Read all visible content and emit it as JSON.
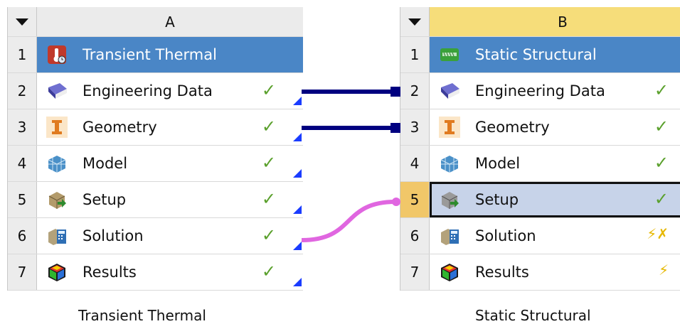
{
  "systems": [
    {
      "column_letter": "A",
      "caption": "Transient Thermal",
      "rows": [
        {
          "num": "1",
          "label": "Transient Thermal",
          "icon": "thermal-system-icon"
        },
        {
          "num": "2",
          "label": "Engineering Data",
          "icon": "engineering-data-icon",
          "status": "✓"
        },
        {
          "num": "3",
          "label": "Geometry",
          "icon": "geometry-icon",
          "status": "✓"
        },
        {
          "num": "4",
          "label": "Model",
          "icon": "model-icon",
          "status": "✓"
        },
        {
          "num": "5",
          "label": "Setup",
          "icon": "setup-icon",
          "status": "✓"
        },
        {
          "num": "6",
          "label": "Solution",
          "icon": "solution-icon",
          "status": "✓"
        },
        {
          "num": "7",
          "label": "Results",
          "icon": "results-icon",
          "status": "✓"
        }
      ]
    },
    {
      "column_letter": "B",
      "caption": "Static Structural",
      "rows": [
        {
          "num": "1",
          "label": "Static Structural",
          "icon": "structural-system-icon"
        },
        {
          "num": "2",
          "label": "Engineering Data",
          "icon": "engineering-data-icon",
          "status": "✓"
        },
        {
          "num": "3",
          "label": "Geometry",
          "icon": "geometry-icon",
          "status": "✓"
        },
        {
          "num": "4",
          "label": "Model",
          "icon": "model-icon",
          "status": "✓"
        },
        {
          "num": "5",
          "label": "Setup",
          "icon": "setup-icon",
          "status": "✓"
        },
        {
          "num": "6",
          "label": "Solution",
          "icon": "solution-icon",
          "status": "⚡✗"
        },
        {
          "num": "7",
          "label": "Results",
          "icon": "results-icon",
          "status": "⚡"
        }
      ]
    }
  ],
  "colors": {
    "share_link": "#000080",
    "transfer_link": "#e066e0",
    "title_row": "#4a86c6",
    "check": "#5aa02c",
    "refresh": "#f0c000",
    "error": "#e00000"
  }
}
